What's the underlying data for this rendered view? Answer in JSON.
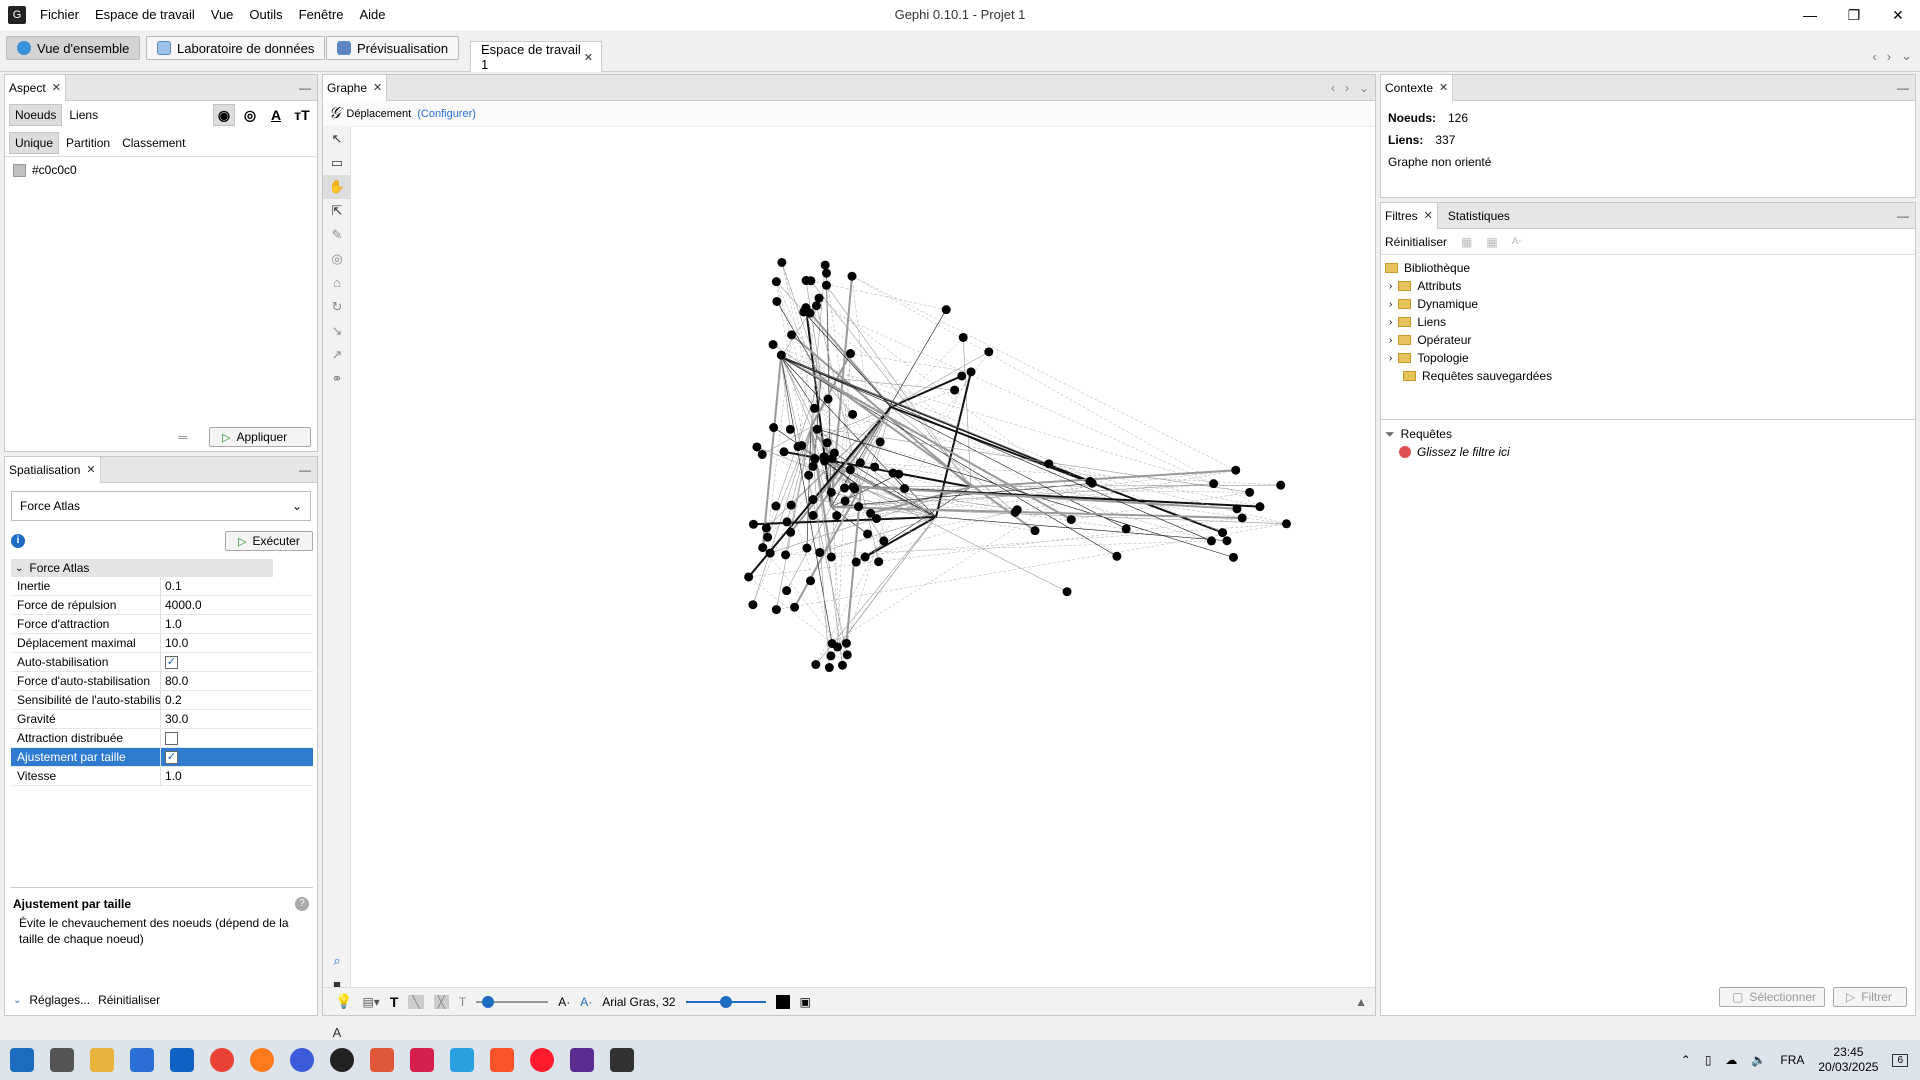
{
  "window": {
    "title": "Gephi 0.10.1 - Projet 1",
    "menu": [
      "Fichier",
      "Espace de travail",
      "Vue",
      "Outils",
      "Fenêtre",
      "Aide"
    ]
  },
  "workspace_bar": {
    "buttons": [
      {
        "label": "Vue d'ensemble",
        "active": true
      },
      {
        "label": "Laboratoire de données",
        "active": false
      },
      {
        "label": "Prévisualisation",
        "active": false
      }
    ],
    "tab": "Espace de travail 1"
  },
  "aspect": {
    "title": "Aspect",
    "subtabs": [
      "Noeuds",
      "Liens"
    ],
    "modes": [
      "Unique",
      "Partition",
      "Classement"
    ],
    "color_value": "#c0c0c0",
    "apply_label": "Appliquer"
  },
  "spatial": {
    "title": "Spatialisation",
    "algorithm": "Force Atlas",
    "run_label": "Exécuter",
    "section": "Force Atlas",
    "properties": [
      {
        "name": "Inertie",
        "value": "0.1"
      },
      {
        "name": "Force de répulsion",
        "value": "4000.0"
      },
      {
        "name": "Force d'attraction",
        "value": "1.0"
      },
      {
        "name": "Déplacement maximal",
        "value": "10.0"
      },
      {
        "name": "Auto-stabilisation",
        "checkbox": true
      },
      {
        "name": "Force d'auto-stabilisation",
        "value": "80.0"
      },
      {
        "name": "Sensibilité de l'auto-stabilisa",
        "value": "0.2"
      },
      {
        "name": "Gravité",
        "value": "30.0"
      },
      {
        "name": "Attraction distribuée",
        "checkbox": false
      },
      {
        "name": "Ajustement par taille",
        "checkbox": true,
        "selected": true
      },
      {
        "name": "Vitesse",
        "value": "1.0"
      }
    ],
    "desc_title": "Ajustement par taille",
    "desc_text": "Évite le chevauchement des noeuds (dépend de la taille de chaque noeud)",
    "settings_label": "Réglages...",
    "reset_label": "Réinitialiser"
  },
  "graph": {
    "title": "Graphe",
    "tool_label": "Déplacement",
    "configure_label": "(Configurer)",
    "font_label": "Arial Gras, 32"
  },
  "contexte": {
    "title": "Contexte",
    "nodes_label": "Noeuds:",
    "nodes_value": "126",
    "edges_label": "Liens:",
    "edges_value": "337",
    "graph_type": "Graphe non orienté"
  },
  "filtres": {
    "tabs": [
      "Filtres",
      "Statistiques"
    ],
    "reset_label": "Réinitialiser",
    "library_label": "Bibliothèque",
    "library_items": [
      "Attributs",
      "Dynamique",
      "Liens",
      "Opérateur",
      "Topologie",
      "Requêtes sauvegardées"
    ],
    "queries_label": "Requêtes",
    "drop_hint": "Glissez le filtre ici",
    "select_label": "Sélectionner",
    "filter_label": "Filtrer"
  },
  "taskbar": {
    "lang": "FRA",
    "time": "23:45",
    "date": "20/03/2025",
    "notif": "6"
  }
}
